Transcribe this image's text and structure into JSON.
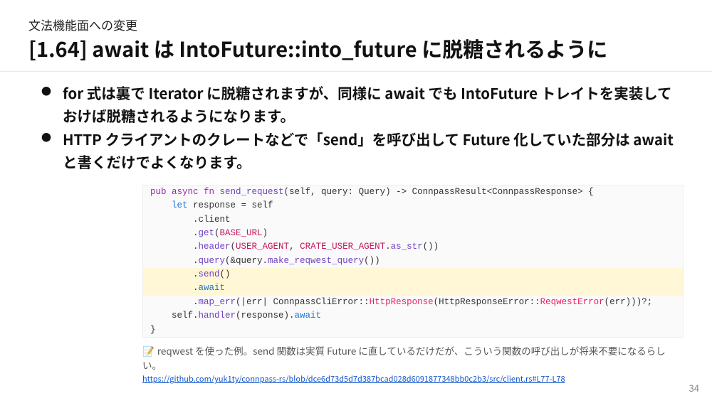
{
  "header": {
    "subtitle": "文法機能面への変更",
    "title": "[1.64] await は IntoFuture::into_future に脱糖されるように"
  },
  "bullets": [
    "for 式は裏で Iterator に脱糖されますが、同様に await でも IntoFuture トレイトを実装しておけば脱糖されるようになります。",
    "HTTP クライアントのクレートなどで「send」を呼び出して Future 化していた部分は await と書くだけでよくなります。"
  ],
  "code": {
    "lines": [
      {
        "hl": false,
        "segments": [
          {
            "t": "pub async fn ",
            "c": "kw"
          },
          {
            "t": "send_request",
            "c": "fn"
          },
          {
            "t": "(self, query: Query) -> ConnpassResult<ConnpassResponse> {",
            "c": ""
          }
        ]
      },
      {
        "hl": false,
        "segments": [
          {
            "t": "    ",
            "c": ""
          },
          {
            "t": "let",
            "c": "kw2"
          },
          {
            "t": " response = self",
            "c": ""
          }
        ]
      },
      {
        "hl": false,
        "segments": [
          {
            "t": "        .client",
            "c": ""
          }
        ]
      },
      {
        "hl": false,
        "segments": [
          {
            "t": "        .",
            "c": ""
          },
          {
            "t": "get",
            "c": "fn"
          },
          {
            "t": "(",
            "c": ""
          },
          {
            "t": "BASE_URL",
            "c": "str"
          },
          {
            "t": ")",
            "c": ""
          }
        ]
      },
      {
        "hl": false,
        "segments": [
          {
            "t": "        .",
            "c": ""
          },
          {
            "t": "header",
            "c": "fn"
          },
          {
            "t": "(",
            "c": ""
          },
          {
            "t": "USER_AGENT",
            "c": "str"
          },
          {
            "t": ", ",
            "c": ""
          },
          {
            "t": "CRATE_USER_AGENT",
            "c": "str"
          },
          {
            "t": ".",
            "c": ""
          },
          {
            "t": "as_str",
            "c": "fn"
          },
          {
            "t": "())",
            "c": ""
          }
        ]
      },
      {
        "hl": false,
        "segments": [
          {
            "t": "        .",
            "c": ""
          },
          {
            "t": "query",
            "c": "fn"
          },
          {
            "t": "(&query.",
            "c": ""
          },
          {
            "t": "make_reqwest_query",
            "c": "fn"
          },
          {
            "t": "())",
            "c": ""
          }
        ]
      },
      {
        "hl": true,
        "segments": [
          {
            "t": "        .",
            "c": ""
          },
          {
            "t": "send",
            "c": "fn"
          },
          {
            "t": "()",
            "c": ""
          }
        ]
      },
      {
        "hl": true,
        "segments": [
          {
            "t": "        .",
            "c": ""
          },
          {
            "t": "await",
            "c": "kw2"
          }
        ]
      },
      {
        "hl": false,
        "segments": [
          {
            "t": "        .",
            "c": ""
          },
          {
            "t": "map_err",
            "c": "fn"
          },
          {
            "t": "(|err| ConnpassCliError::",
            "c": ""
          },
          {
            "t": "HttpResponse",
            "c": "ty"
          },
          {
            "t": "(HttpResponseError::",
            "c": ""
          },
          {
            "t": "ReqwestError",
            "c": "ty"
          },
          {
            "t": "(err)))?;",
            "c": ""
          }
        ]
      },
      {
        "hl": false,
        "segments": [
          {
            "t": "    self.",
            "c": ""
          },
          {
            "t": "handler",
            "c": "fn"
          },
          {
            "t": "(response).",
            "c": ""
          },
          {
            "t": "await",
            "c": "kw2"
          }
        ]
      },
      {
        "hl": false,
        "segments": [
          {
            "t": "}",
            "c": ""
          }
        ]
      }
    ]
  },
  "note": {
    "icon": "📝",
    "text": "reqwest を使った例。send 関数は実質 Future に直しているだけだが、こういう関数の呼び出しが将来不要になるらしい。"
  },
  "link": {
    "url": "https://github.com/yuk1ty/connpass-rs/blob/dce6d73d5d7d387bcad028d6091877348bb0c2b3/src/client.rs#L77-L78"
  },
  "page_number": "34"
}
